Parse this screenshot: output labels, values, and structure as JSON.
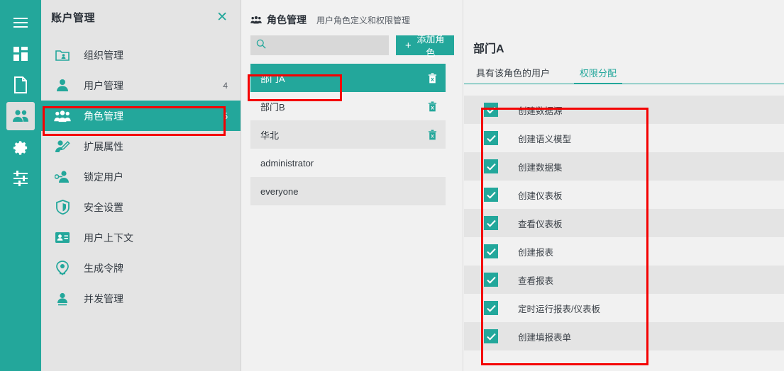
{
  "theme": {
    "accent": "#23a79b",
    "annotation": "#f40000",
    "panel_bg": "#e4e4e4",
    "content_bg": "#f1f1f1",
    "row_shade": "#e4e4e4"
  },
  "rail": {
    "items": [
      {
        "name": "menu-icon",
        "active": false
      },
      {
        "name": "dashboard-icon",
        "active": false
      },
      {
        "name": "document-icon",
        "active": false
      },
      {
        "name": "users-icon",
        "active": true
      },
      {
        "name": "gear-icon",
        "active": false
      },
      {
        "name": "sliders-icon",
        "active": false
      }
    ]
  },
  "account_panel": {
    "title": "账户管理",
    "close_label": "✕",
    "items": [
      {
        "label": "组织管理",
        "count": "",
        "icon": "folder-user-icon",
        "selected": false
      },
      {
        "label": "用户管理",
        "count": "4",
        "icon": "user-icon",
        "selected": false
      },
      {
        "label": "角色管理",
        "count": "5",
        "icon": "users-group-icon",
        "selected": true
      },
      {
        "label": "扩展属性",
        "count": "",
        "icon": "user-edit-icon",
        "selected": false
      },
      {
        "label": "锁定用户",
        "count": "",
        "icon": "user-key-icon",
        "selected": false
      },
      {
        "label": "安全设置",
        "count": "",
        "icon": "shield-icon",
        "selected": false
      },
      {
        "label": "用户上下文",
        "count": "",
        "icon": "id-card-icon",
        "selected": false
      },
      {
        "label": "生成令牌",
        "count": "",
        "icon": "token-icon",
        "selected": false
      },
      {
        "label": "并发管理",
        "count": "",
        "icon": "user-concurrent-icon",
        "selected": false
      }
    ]
  },
  "role_column": {
    "header_title": "角色管理",
    "header_subtitle": "用户角色定义和权限管理",
    "search": {
      "value": "",
      "placeholder": ""
    },
    "add_button": {
      "label": "添加角色",
      "plus": "+"
    },
    "roles": [
      {
        "name": "部门A",
        "selected": true,
        "shade": false,
        "deletable": true
      },
      {
        "name": "部门B",
        "selected": false,
        "shade": false,
        "deletable": true
      },
      {
        "name": "华北",
        "selected": false,
        "shade": true,
        "deletable": true
      },
      {
        "name": "administrator",
        "selected": false,
        "shade": false,
        "deletable": false
      },
      {
        "name": "everyone",
        "selected": false,
        "shade": true,
        "deletable": false
      }
    ]
  },
  "detail": {
    "title": "部门A",
    "tabs": [
      {
        "label": "具有该角色的用户",
        "active": false
      },
      {
        "label": "权限分配",
        "active": true
      }
    ],
    "permissions": [
      {
        "label": "创建数据源",
        "checked": true,
        "shade": true
      },
      {
        "label": "创建语义模型",
        "checked": true,
        "shade": false
      },
      {
        "label": "创建数据集",
        "checked": true,
        "shade": true
      },
      {
        "label": "创建仪表板",
        "checked": true,
        "shade": false
      },
      {
        "label": "查看仪表板",
        "checked": true,
        "shade": true
      },
      {
        "label": "创建报表",
        "checked": true,
        "shade": false
      },
      {
        "label": "查看报表",
        "checked": true,
        "shade": true
      },
      {
        "label": "定时运行报表/仪表板",
        "checked": true,
        "shade": false
      },
      {
        "label": "创建填报表单",
        "checked": true,
        "shade": true
      }
    ]
  },
  "annotations": [
    {
      "name": "highlight-sidebar-role-management"
    },
    {
      "name": "highlight-role-department-a"
    },
    {
      "name": "highlight-permission-list"
    }
  ]
}
